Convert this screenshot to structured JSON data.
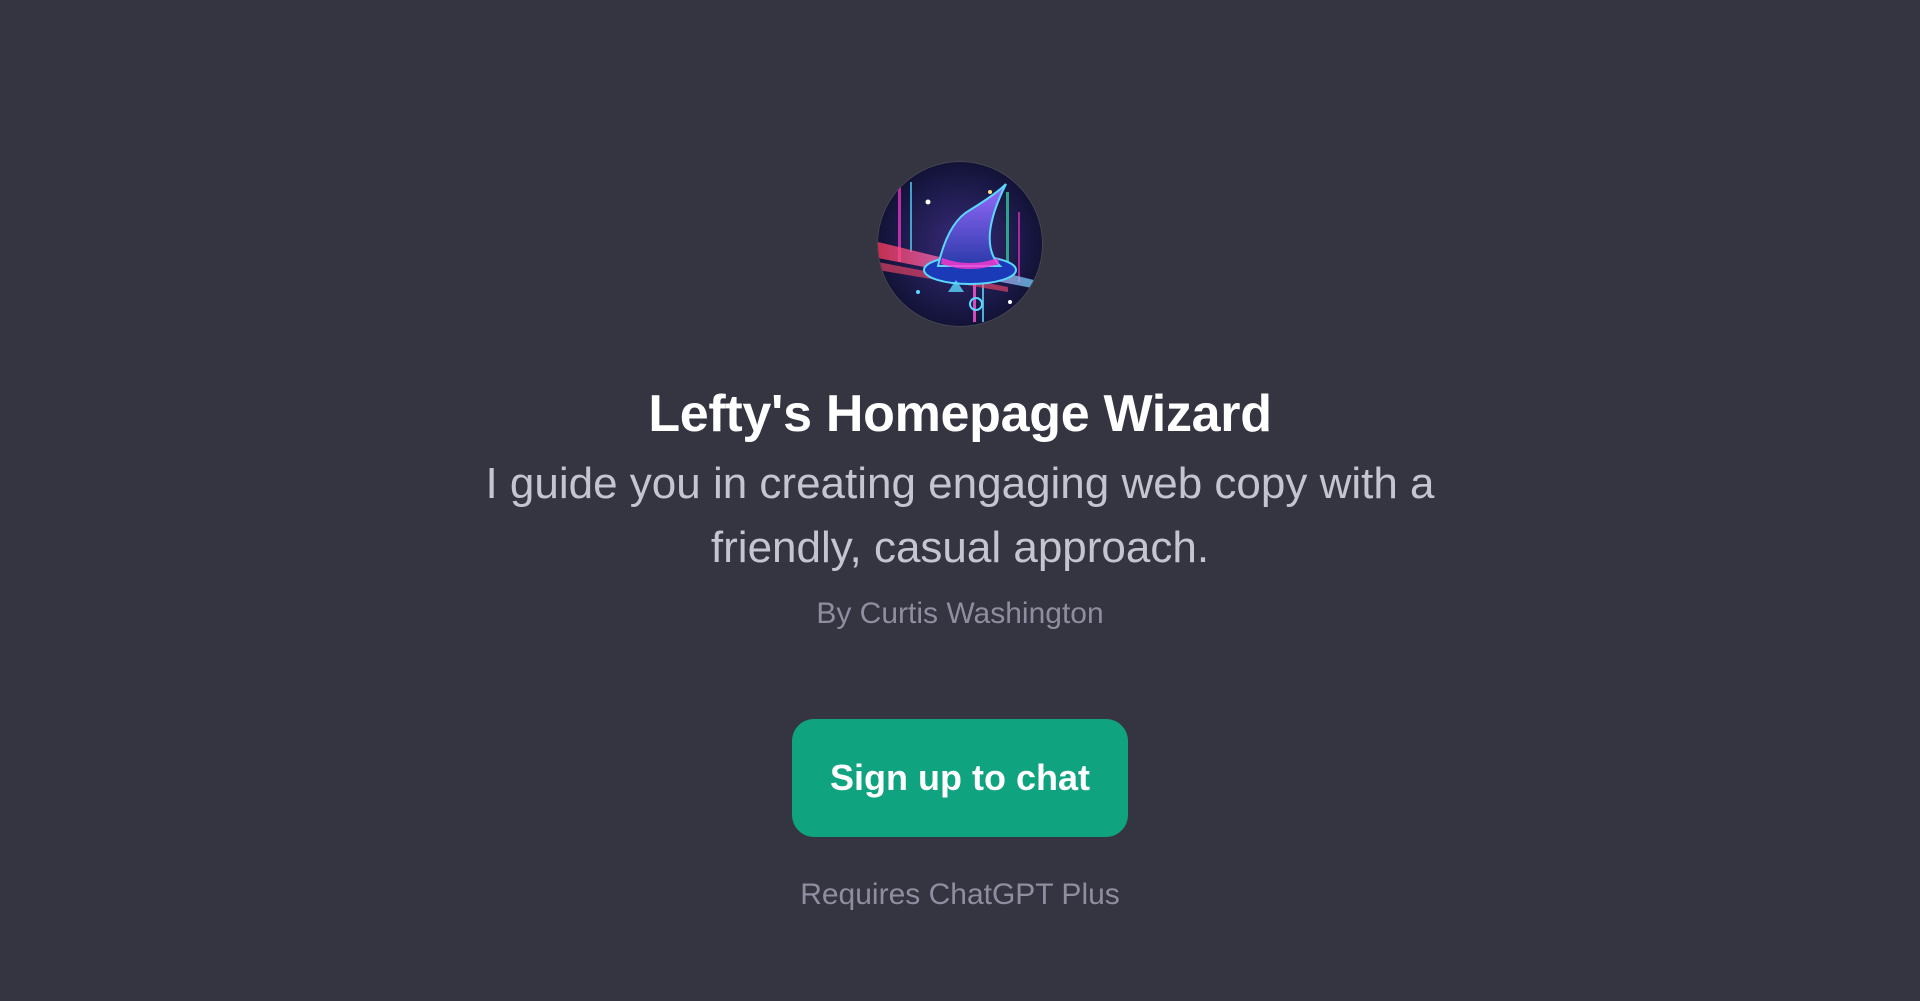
{
  "gpt": {
    "name": "Lefty's Homepage Wizard",
    "description": "I guide you in creating engaging web copy with a friendly, casual approach.",
    "author": "By Curtis Washington",
    "avatar_icon": "wizard-hat-avatar-icon"
  },
  "cta": {
    "label": "Sign up to chat"
  },
  "footer": {
    "requirement": "Requires ChatGPT Plus"
  },
  "colors": {
    "background": "#343541",
    "title": "#ffffff",
    "description": "#c5c5d2",
    "muted": "#8e8ea0",
    "button": "#10a37f"
  }
}
